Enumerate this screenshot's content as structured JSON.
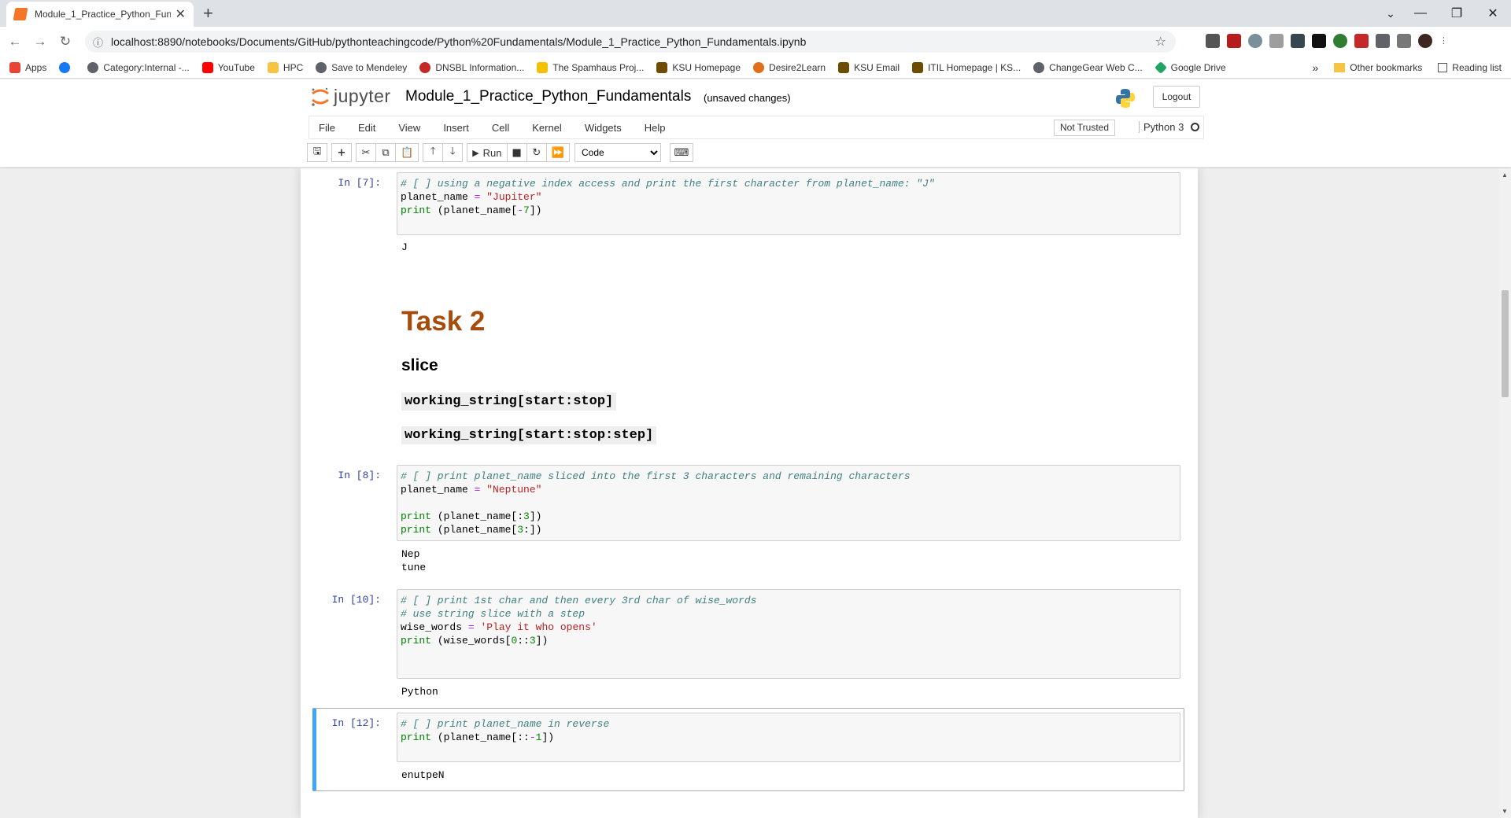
{
  "browser": {
    "tab_title": "Module_1_Practice_Python_Fund",
    "url": "localhost:8890/notebooks/Documents/GitHub/pythonteachingcode/Python%20Fundamentals/Module_1_Practice_Python_Fundamentals.ipynb",
    "bookmarks": [
      {
        "label": "Apps",
        "icon_color": "#ea4335"
      },
      {
        "label": "",
        "icon_color": "#1877f2"
      },
      {
        "label": "Category:Internal -...",
        "icon_color": "#5f6368"
      },
      {
        "label": "YouTube",
        "icon_color": "#ff0000"
      },
      {
        "label": "HPC",
        "icon_color": "#f6c343"
      },
      {
        "label": "Save to Mendeley",
        "icon_color": "#5f6368"
      },
      {
        "label": "DNSBL Information...",
        "icon_color": "#c62828"
      },
      {
        "label": "The Spamhaus Proj...",
        "icon_color": "#f2c200"
      },
      {
        "label": "KSU Homepage",
        "icon_color": "#6d4c00"
      },
      {
        "label": "Desire2Learn",
        "icon_color": "#e0701a"
      },
      {
        "label": "KSU Email",
        "icon_color": "#6d4c00"
      },
      {
        "label": "ITIL Homepage | KS...",
        "icon_color": "#6d4c00"
      },
      {
        "label": "ChangeGear Web C...",
        "icon_color": "#5f6368"
      },
      {
        "label": "Google Drive",
        "icon_color": "#1fa463"
      }
    ],
    "overflow": "»",
    "other_bookmarks": "Other bookmarks",
    "reading_list": "Reading list"
  },
  "jupyter": {
    "logo_text": "jupyter",
    "notebook_name": "Module_1_Practice_Python_Fundamentals",
    "save_status": "(unsaved changes)",
    "logout": "Logout",
    "menus": [
      "File",
      "Edit",
      "View",
      "Insert",
      "Cell",
      "Kernel",
      "Widgets",
      "Help"
    ],
    "trust": "Not Trusted",
    "kernel": "Python 3",
    "run_label": "Run",
    "cell_type": "Code"
  },
  "cells": {
    "c7": {
      "prompt": "In [7]:",
      "comment": "# [ ] using a negative index access and print the first character from planet_name: \"J\"",
      "output": "J"
    },
    "md": {
      "h1": "Task 2",
      "h3": "slice",
      "code1": "working_string[start:stop]",
      "code2": "working_string[start:stop:step]"
    },
    "c8": {
      "prompt": "In [8]:",
      "comment": "# [ ] print planet_name sliced into the first 3 characters and remaining characters",
      "output1": "Nep",
      "output2": "tune"
    },
    "c10": {
      "prompt": "In [10]:",
      "comment1": "# [ ] print 1st char and then every 3rd char of wise_words",
      "comment2": "# use string slice with a step",
      "output": "Python"
    },
    "c12": {
      "prompt": "In [12]:",
      "comment": "# [ ] print planet_name in reverse",
      "output": "enutpeN"
    }
  }
}
